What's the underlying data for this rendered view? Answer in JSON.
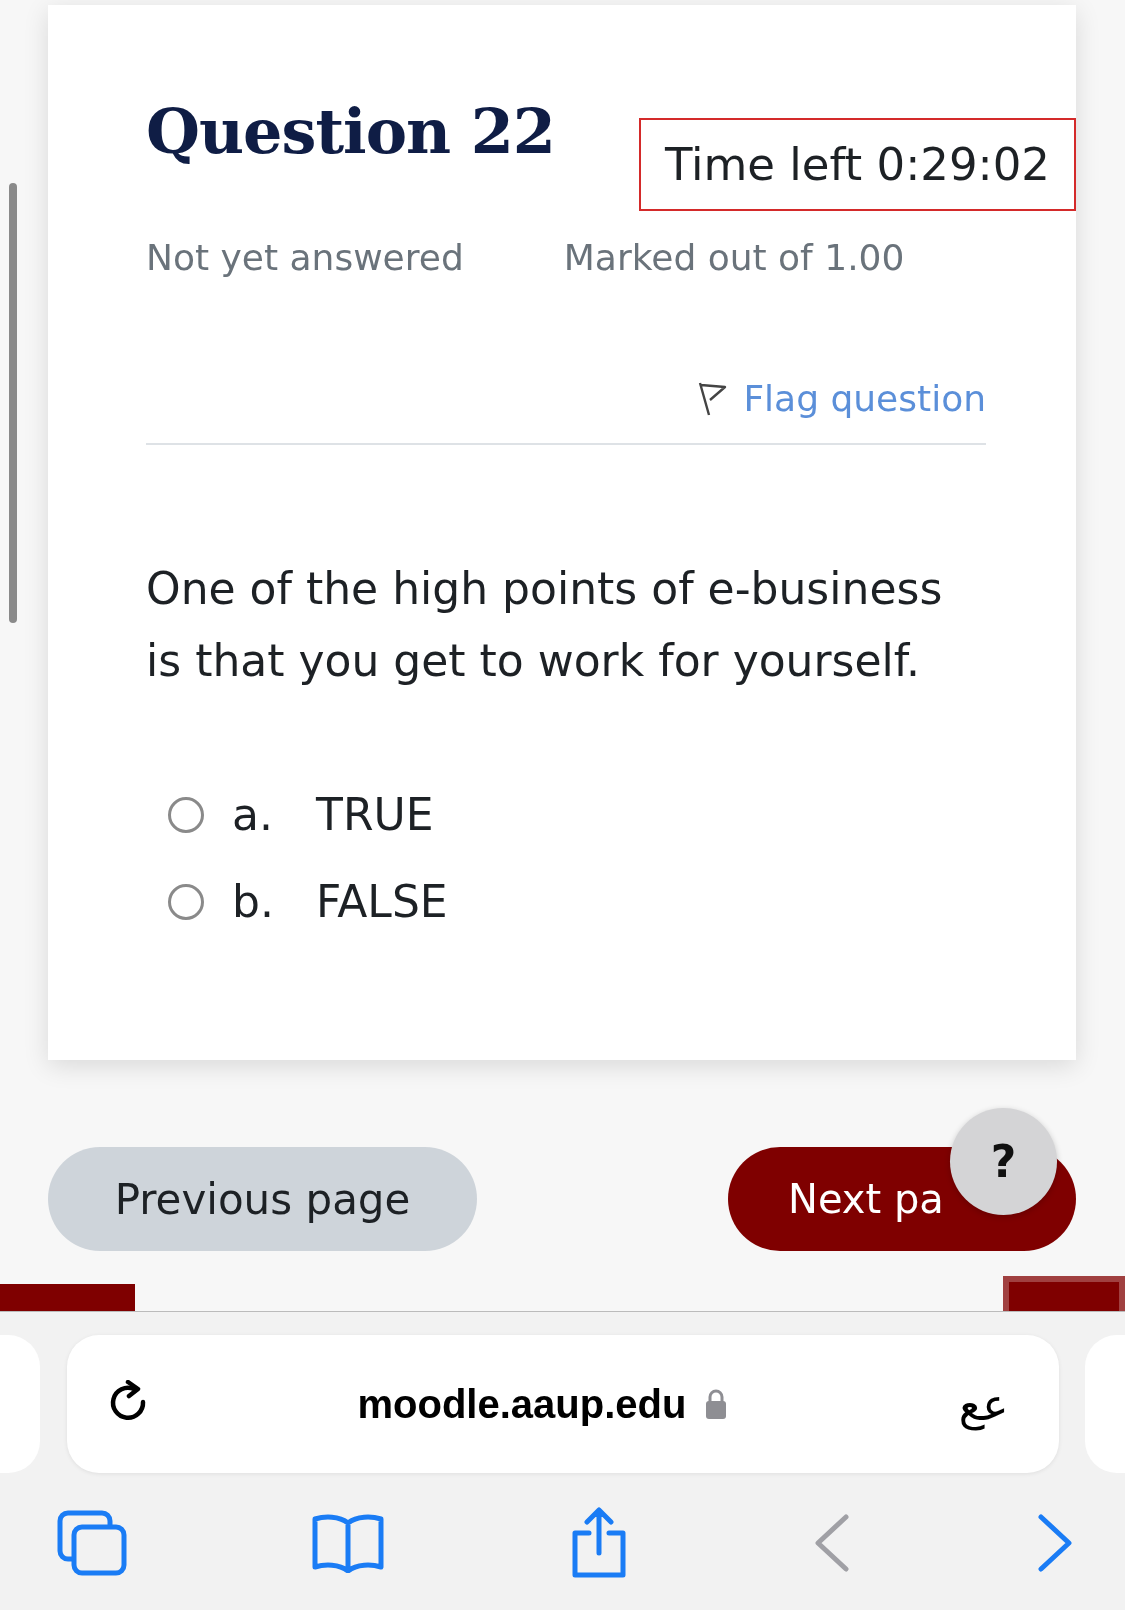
{
  "question": {
    "title": "Question 22",
    "timer": "Time left 0:29:02",
    "status": "Not yet answered",
    "marks": "Marked out of 1.00",
    "flag": "Flag question",
    "text": "One of the high points of e-business is that you get to work for yourself.",
    "options": [
      {
        "letter": "a.",
        "label": "TRUE",
        "selected": false
      },
      {
        "letter": "b.",
        "label": "FALSE",
        "selected": false
      }
    ]
  },
  "nav": {
    "previous": "Previous page",
    "next": "Next pa",
    "help": "?"
  },
  "browser": {
    "url": "moodle.aaup.edu",
    "reader": "عع"
  }
}
